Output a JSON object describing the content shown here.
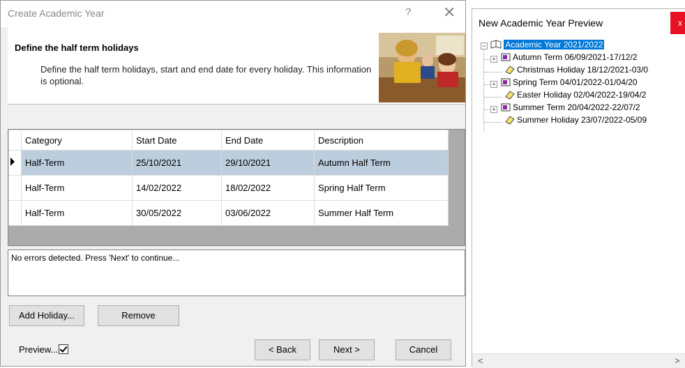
{
  "dialog": {
    "title": "Create Academic Year",
    "help": "?",
    "close": "✕",
    "header_title": "Define the half term holidays",
    "header_desc": "Define the half term holidays, start and end date for every holiday. This information is optional."
  },
  "grid": {
    "columns": [
      "Category",
      "Start Date",
      "End Date",
      "Description"
    ],
    "rows": [
      {
        "category": "Half-Term",
        "start": "25/10/2021",
        "end": "29/10/2021",
        "description": "Autumn Half Term"
      },
      {
        "category": "Half-Term",
        "start": "14/02/2022",
        "end": "18/02/2022",
        "description": "Spring Half Term"
      },
      {
        "category": "Half-Term",
        "start": "30/05/2022",
        "end": "03/06/2022",
        "description": "Summer Half Term"
      }
    ]
  },
  "message": "No errors detected. Press 'Next' to continue...",
  "buttons": {
    "add_holiday": "Add Holiday...",
    "remove": "Remove",
    "back": "< Back",
    "next": "Next >",
    "cancel": "Cancel"
  },
  "preview_label": "Preview...",
  "preview_panel": {
    "title": "New Academic Year Preview",
    "close": "x",
    "tree": {
      "root": "Academic Year 2021/2022",
      "items": [
        {
          "label": "Autumn Term 06/09/2021-17/12/2",
          "type": "term"
        },
        {
          "label": "Christmas Holiday 18/12/2021-03/0",
          "type": "holiday"
        },
        {
          "label": "Spring Term 04/01/2022-01/04/20",
          "type": "term"
        },
        {
          "label": "Easter Holiday 02/04/2022-19/04/2",
          "type": "holiday"
        },
        {
          "label": "Summer Term 20/04/2022-22/07/2",
          "type": "term"
        },
        {
          "label": "Summer Holiday 23/07/2022-05/09",
          "type": "holiday"
        }
      ]
    },
    "scroll_left": "<",
    "scroll_right": ">"
  },
  "colors": {
    "selected_row": "#bccddd",
    "tree_selection": "#0078d7",
    "close_red": "#e81123"
  }
}
